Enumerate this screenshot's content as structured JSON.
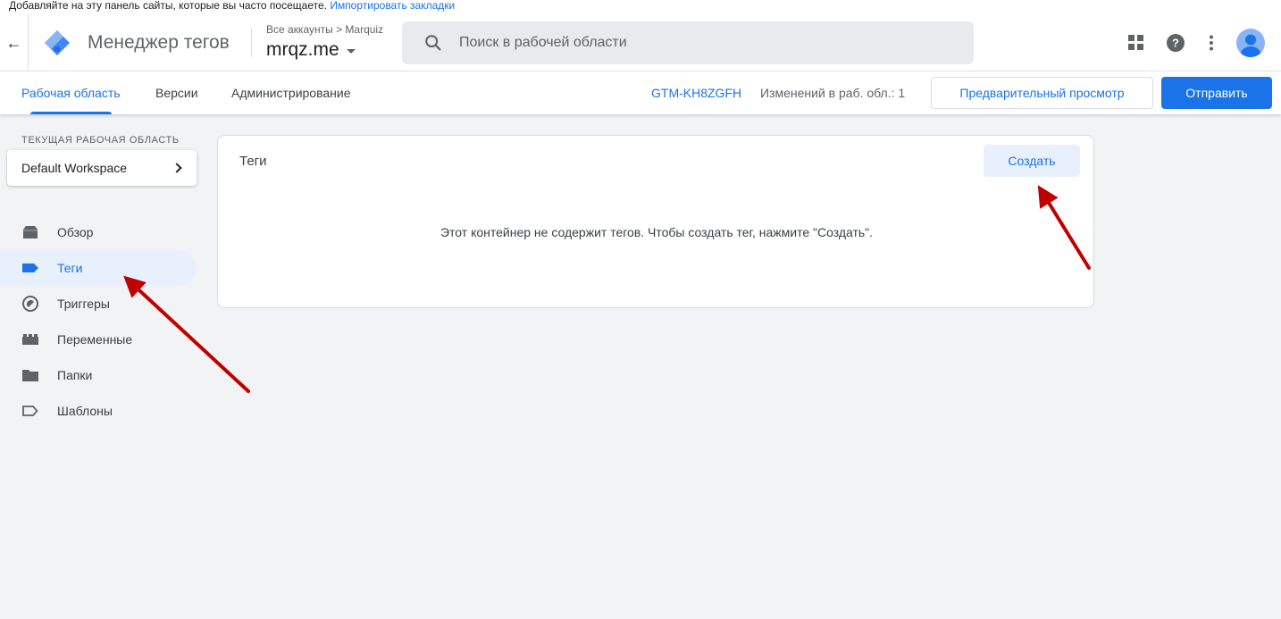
{
  "bookmarks_bar": {
    "text": "Добавляйте на эту панель сайты, которые вы часто посещаете.",
    "link": "Импортировать закладки"
  },
  "header": {
    "product_name": "Менеджер тегов",
    "breadcrumb": "Все аккаунты > Marquiz",
    "container_name": "mrqz.me",
    "search_placeholder": "Поиск в рабочей области"
  },
  "subnav": {
    "tabs": [
      {
        "label": "Рабочая область",
        "active": true
      },
      {
        "label": "Версии",
        "active": false
      },
      {
        "label": "Администрирование",
        "active": false
      }
    ],
    "container_id": "GTM-KH8ZGFH",
    "changes": "Изменений в раб. обл.: 1",
    "preview_label": "Предварительный просмотр",
    "submit_label": "Отправить"
  },
  "sidebar": {
    "workspace_label": "ТЕКУЩАЯ РАБОЧАЯ ОБЛАСТЬ",
    "workspace_name": "Default Workspace",
    "items": [
      {
        "label": "Обзор",
        "icon": "overview-icon",
        "active": false
      },
      {
        "label": "Теги",
        "icon": "tag-icon",
        "active": true
      },
      {
        "label": "Триггеры",
        "icon": "trigger-icon",
        "active": false
      },
      {
        "label": "Переменные",
        "icon": "variable-icon",
        "active": false
      },
      {
        "label": "Папки",
        "icon": "folder-icon",
        "active": false
      },
      {
        "label": "Шаблоны",
        "icon": "template-icon",
        "active": false
      }
    ]
  },
  "main": {
    "card_title": "Теги",
    "create_label": "Создать",
    "empty_message": "Этот контейнер не содержит тегов. Чтобы создать тег, нажмите \"Создать\"."
  },
  "colors": {
    "accent": "#1a73e8",
    "annotation_arrow": "#c00000"
  }
}
